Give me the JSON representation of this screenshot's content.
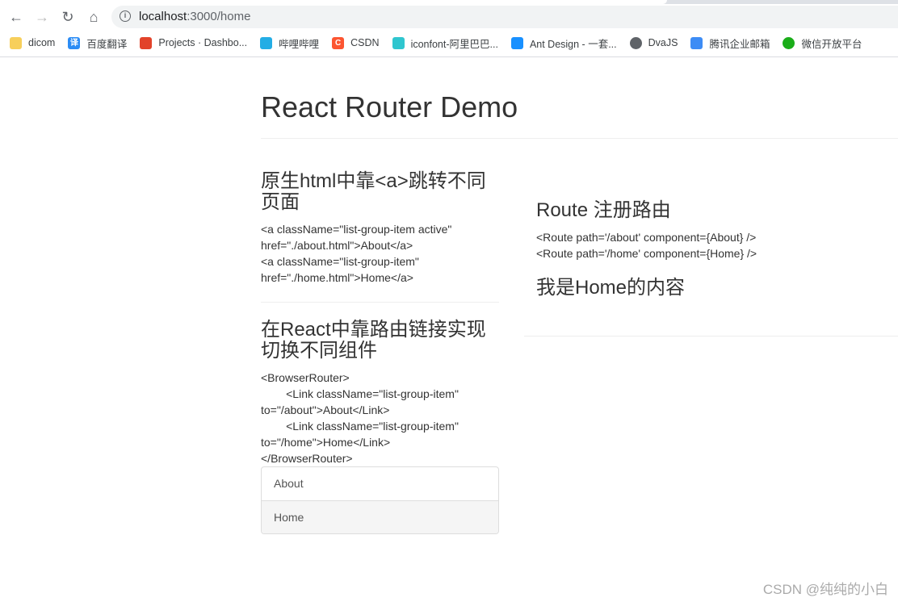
{
  "browser": {
    "url_host": "localhost",
    "url_path": ":3000/home",
    "bookmarks": [
      {
        "label": "dicom",
        "icon": "folder-icon",
        "color": "#f7cf5b"
      },
      {
        "label": "百度翻译",
        "icon": "translate-icon",
        "color": "#2b8cf5",
        "glyph": "译"
      },
      {
        "label": "Projects · Dashbo...",
        "icon": "gitlab-icon",
        "color": "#e2432a"
      },
      {
        "label": "哔哩哔哩",
        "icon": "bilibili-icon",
        "color": "#23ade5"
      },
      {
        "label": "CSDN",
        "icon": "csdn-icon",
        "color": "#fc5531",
        "glyph": "C"
      },
      {
        "label": "iconfont-阿里巴巴...",
        "icon": "iconfont-icon",
        "color": "#2fc6cf"
      },
      {
        "label": "Ant Design - 一套...",
        "icon": "antdesign-icon",
        "color": "#1890ff"
      },
      {
        "label": "DvaJS",
        "icon": "globe-icon",
        "color": "#5f6368"
      },
      {
        "label": "腾讯企业邮箱",
        "icon": "tencent-mail-icon",
        "color": "#3d8cf5"
      },
      {
        "label": "微信开放平台",
        "icon": "wechat-icon",
        "color": "#1aad19"
      }
    ]
  },
  "page": {
    "title": "React Router Demo",
    "left": {
      "heading1": "原生html中靠<a>跳转不同页面",
      "code1": "<a className=\"list-group-item active\"\nhref=\"./about.html\">About</a>\n<a className=\"list-group-item\"\nhref=\"./home.html\">Home</a>",
      "heading2": "在React中靠路由链接实现切换不同组件",
      "code2": "<BrowserRouter>\n        <Link className=\"list-group-item\"\nto=\"/about\">About</Link>\n        <Link className=\"list-group-item\"\nto=\"/home\">Home</Link>\n</BrowserRouter>",
      "links": [
        "About",
        "Home"
      ]
    },
    "right": {
      "heading": "Route 注册路由",
      "code": "<Route path='/about' component={About} />\n<Route path='/home' component={Home} />",
      "content": "我是Home的内容"
    }
  },
  "watermark": "CSDN @纯纯的小白"
}
